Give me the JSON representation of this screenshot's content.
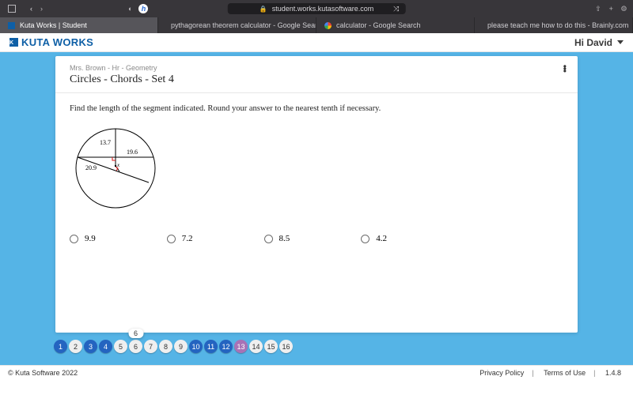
{
  "browser": {
    "url": "student.works.kutasoftware.com",
    "tabs": [
      {
        "label": "Kuta Works | Student",
        "active": true,
        "icon": "kuta"
      },
      {
        "label": "pythagorean theorem calculator - Google Search",
        "active": false,
        "icon": "google"
      },
      {
        "label": "calculator - Google Search",
        "active": false,
        "icon": "google"
      },
      {
        "label": "please teach me how to do this - Brainly.com",
        "active": false,
        "icon": "brainly"
      }
    ]
  },
  "header": {
    "brand": "KUTA WORKS",
    "greeting": "Hi David"
  },
  "assignment": {
    "breadcrumb": "Mrs. Brown - Hr - Geometry",
    "title": "Circles - Chords - Set 4",
    "prompt": "Find the length of the segment indicated.  Round your answer to the nearest tenth if necessary.",
    "figure": {
      "labels": {
        "a": "13.7",
        "b": "19.6",
        "c": "20.9",
        "x": "x"
      }
    },
    "choices": [
      "9.9",
      "7.2",
      "8.5",
      "4.2"
    ]
  },
  "qnav": {
    "hover_index": 6,
    "hover_label": "6",
    "items": [
      {
        "n": "1",
        "state": "blue"
      },
      {
        "n": "2",
        "state": ""
      },
      {
        "n": "3",
        "state": "blue"
      },
      {
        "n": "4",
        "state": "blue"
      },
      {
        "n": "5",
        "state": ""
      },
      {
        "n": "6",
        "state": "hover"
      },
      {
        "n": "7",
        "state": ""
      },
      {
        "n": "8",
        "state": ""
      },
      {
        "n": "9",
        "state": ""
      },
      {
        "n": "10",
        "state": "blue"
      },
      {
        "n": "11",
        "state": "blue"
      },
      {
        "n": "12",
        "state": "blue"
      },
      {
        "n": "13",
        "state": "purple"
      },
      {
        "n": "14",
        "state": ""
      },
      {
        "n": "15",
        "state": ""
      },
      {
        "n": "16",
        "state": ""
      }
    ]
  },
  "footer": {
    "copyright": "© Kuta Software 2022",
    "links": [
      "Privacy Policy",
      "Terms of Use"
    ],
    "version": "1.4.8"
  }
}
